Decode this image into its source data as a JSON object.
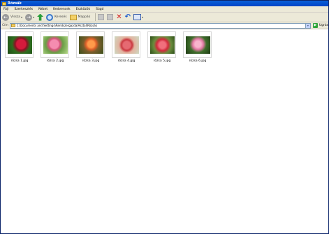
{
  "window": {
    "title": "Rózsák"
  },
  "menu": [
    "Fájl",
    "Szerkesztés",
    "Nézet",
    "Kedvencek",
    "Eszközök",
    "Súgó"
  ],
  "toolbar": {
    "back_label": "Vissza",
    "search_label": "Keresés",
    "folders_label": "Mappák"
  },
  "address": {
    "label": "Cím",
    "path": "C:\\Documents and Settings\\Rendszergazda\\Asztal\\Rózsák",
    "go_label": "Ugrás"
  },
  "files": [
    {
      "name": "rózsa 1.jpg"
    },
    {
      "name": "rózsa 2.jpg"
    },
    {
      "name": "rózsa 3.jpg"
    },
    {
      "name": "rózsa 4.jpg"
    },
    {
      "name": "rózsa 5.jpg"
    },
    {
      "name": "rózsa 6.jpg"
    }
  ],
  "colors": {
    "titlebar": "#0a5fd8",
    "chrome": "#ece9d8"
  }
}
